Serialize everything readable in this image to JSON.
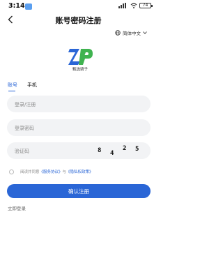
{
  "status_bar": {
    "time": "3:14",
    "battery": "74",
    "icons": [
      "notification-icon",
      "wifi-icon",
      "signal-icon",
      "battery-icon"
    ]
  },
  "header": {
    "title": "账号密码注册",
    "back_icon": "chevron-left-icon"
  },
  "language": {
    "label": "简体中文",
    "icon": "globe-icon"
  },
  "brand": {
    "logo_letters": "ZP",
    "name": "甄选骑子",
    "colors": {
      "z": "#2a66d6",
      "p": "#3fb34f"
    }
  },
  "tabs": [
    {
      "label": "账号",
      "active": true
    },
    {
      "label": "手机",
      "active": false
    }
  ],
  "form": {
    "account_placeholder": "登录/注册",
    "password_placeholder": "登录密码",
    "captcha_placeholder": "验证码",
    "captcha_digits": [
      "8",
      "4",
      "2",
      "5"
    ]
  },
  "agreement": {
    "prefix": "阅读并同意",
    "service_link": "《服务协议》",
    "connector": "与",
    "privacy_link": "《隐私权政策》"
  },
  "submit_label": "确认注册",
  "login_link": "立即登录",
  "accent_color": "#2a66d6"
}
